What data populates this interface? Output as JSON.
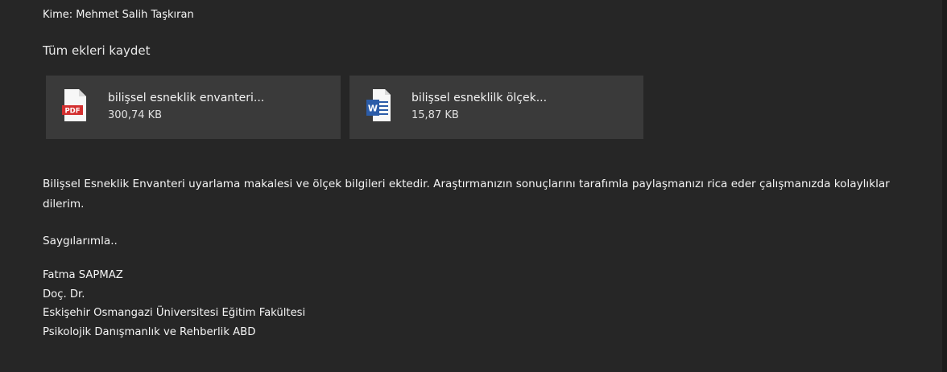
{
  "header": {
    "to_label": "Kime: Mehmet Salih Taşkıran"
  },
  "attachments_bar": {
    "save_all_label": "Tüm ekleri kaydet"
  },
  "attachments": [
    {
      "name": "bilişsel esneklik envanteri...",
      "size": "300,74 KB",
      "icon": "pdf-file-icon",
      "icon_text": "PDF",
      "icon_color": "#d32f2f"
    },
    {
      "name": "bilişsel esneklilk ölçek...",
      "size": "15,87 KB",
      "icon": "word-file-icon",
      "icon_text": "W",
      "icon_color": "#2b5ca8"
    }
  ],
  "message": {
    "paragraph": "Bilişsel Esneklik Envanteri uyarlama makalesi ve ölçek bilgileri ektedir. Araştırmanızın sonuçlarını tarafımla paylaşmanızı rica eder çalışmanızda kolaylıklar dilerim.",
    "closing": "Saygılarımla..",
    "signature": [
      "Fatma SAPMAZ",
      "Doç. Dr.",
      "Eskişehir Osmangazi Üniversitesi Eğitim Fakültesi",
      "Psikolojik Danışmanlık ve Rehberlik ABD"
    ]
  },
  "colors": {
    "background": "#262626",
    "attachment_card": "#3a3a3a",
    "text": "#f5f5f5"
  }
}
